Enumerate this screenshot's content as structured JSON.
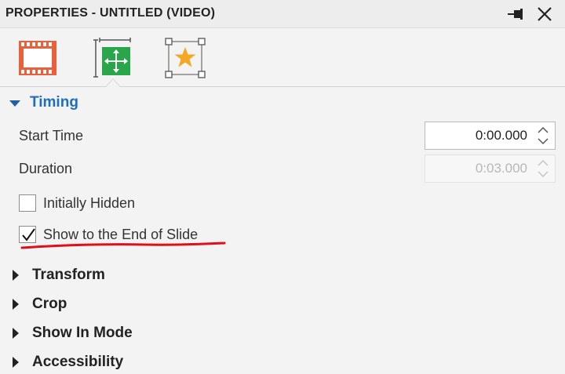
{
  "panel": {
    "title": "PROPERTIES - UNTITLED (VIDEO)"
  },
  "toolbar": {
    "tabs": [
      {
        "icon": "film-strip-icon"
      },
      {
        "icon": "move-resize-icon",
        "active": true
      },
      {
        "icon": "star-effects-icon"
      }
    ]
  },
  "timing": {
    "header": "Timing",
    "start_time_label": "Start Time",
    "start_time_value": "0:00.000",
    "duration_label": "Duration",
    "duration_value": "0:03.000",
    "initially_hidden_label": "Initially Hidden",
    "initially_hidden_checked": false,
    "show_to_end_label": "Show to the End of Slide",
    "show_to_end_checked": true
  },
  "sections": {
    "transform": "Transform",
    "crop": "Crop",
    "show_in_mode": "Show In Mode",
    "accessibility": "Accessibility"
  },
  "colors": {
    "accent": "#1f6fb8",
    "annotation": "#e0101a",
    "film": "#e8603c",
    "position_tile": "#2aa64a",
    "star": "#f5a623"
  }
}
